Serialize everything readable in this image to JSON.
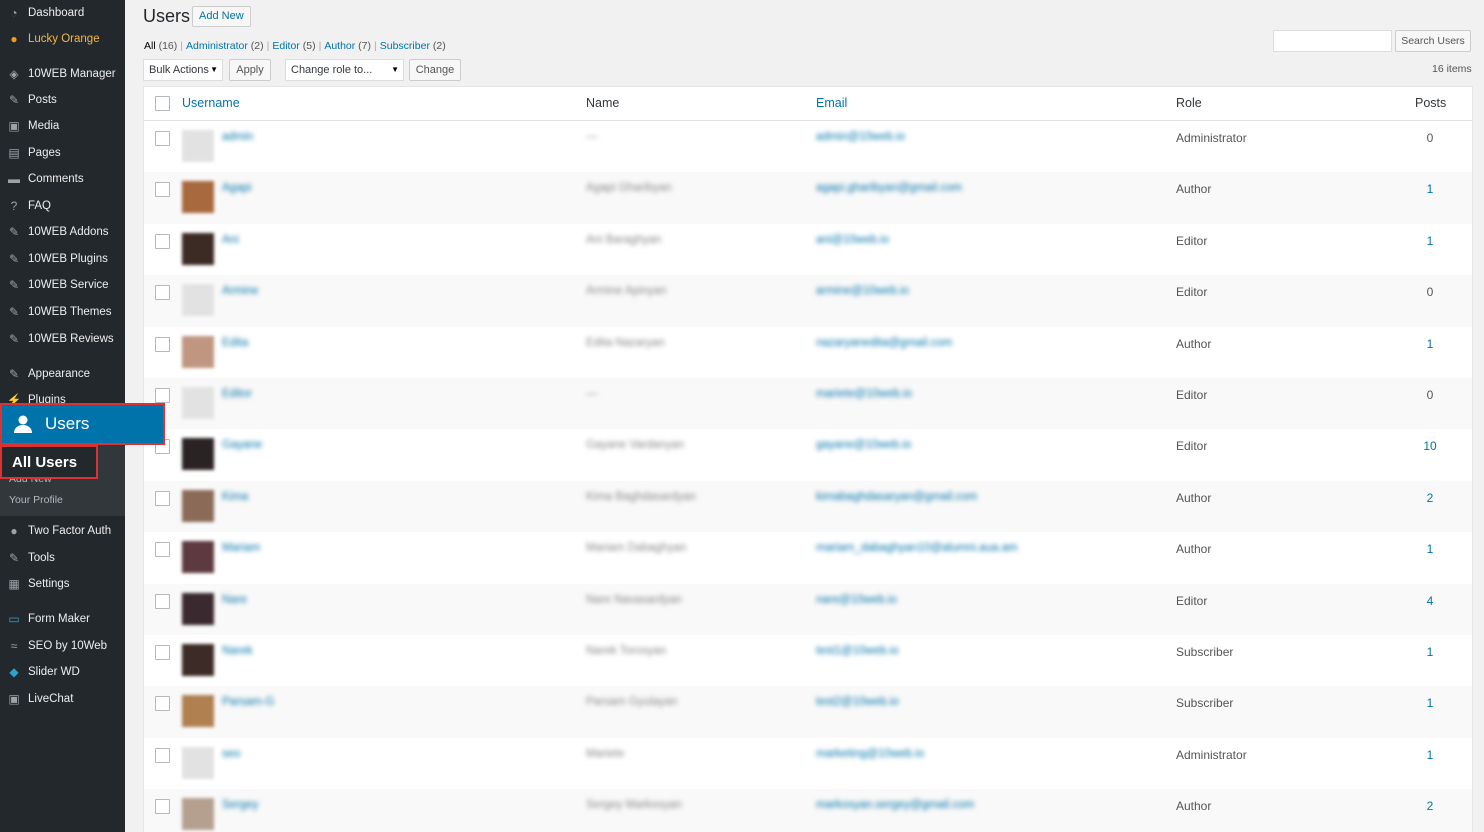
{
  "sidebar": {
    "items": [
      {
        "label": "Dashboard",
        "icon": "dashboard-icon"
      },
      {
        "label": "Lucky Orange",
        "icon": "lucky-orange-icon"
      },
      {
        "label": "10WEB Manager",
        "icon": "diamond-icon"
      },
      {
        "label": "Posts",
        "icon": "pin-icon"
      },
      {
        "label": "Media",
        "icon": "media-icon"
      },
      {
        "label": "Pages",
        "icon": "pages-icon"
      },
      {
        "label": "Comments",
        "icon": "comment-icon"
      },
      {
        "label": "FAQ",
        "icon": "question-icon"
      },
      {
        "label": "10WEB Addons",
        "icon": "pin-icon"
      },
      {
        "label": "10WEB Plugins",
        "icon": "pin-icon"
      },
      {
        "label": "10WEB Service",
        "icon": "pin-icon"
      },
      {
        "label": "10WEB Themes",
        "icon": "pin-icon"
      },
      {
        "label": "10WEB Reviews",
        "icon": "pin-icon"
      },
      {
        "label": "Appearance",
        "icon": "brush-icon"
      },
      {
        "label": "Plugins",
        "icon": "plug-icon"
      },
      {
        "label": "Two Factor Auth",
        "icon": "lock-icon"
      },
      {
        "label": "Tools",
        "icon": "wrench-icon"
      },
      {
        "label": "Settings",
        "icon": "settings-icon"
      },
      {
        "label": "Form Maker",
        "icon": "form-icon"
      },
      {
        "label": "SEO by 10Web",
        "icon": "seo-icon"
      },
      {
        "label": "Slider WD",
        "icon": "slider-icon"
      },
      {
        "label": "LiveChat",
        "icon": "chat-icon"
      }
    ],
    "users_label": "Users",
    "submenu": {
      "all_users": "All Users",
      "add_new": "Add New",
      "your_profile": "Your Profile"
    }
  },
  "header": {
    "title": "Users",
    "add_new": "Add New"
  },
  "filters": [
    {
      "label": "All",
      "count": "(16)"
    },
    {
      "label": "Administrator",
      "count": "(2)"
    },
    {
      "label": "Editor",
      "count": "(5)"
    },
    {
      "label": "Author",
      "count": "(7)"
    },
    {
      "label": "Subscriber",
      "count": "(2)"
    }
  ],
  "search": {
    "button": "Search Users",
    "value": ""
  },
  "toolbar": {
    "bulk_actions": "Bulk Actions",
    "apply": "Apply",
    "change_role": "Change role to...",
    "change": "Change",
    "items_count": "16 items"
  },
  "table": {
    "columns": {
      "username": "Username",
      "name": "Name",
      "email": "Email",
      "role": "Role",
      "posts": "Posts"
    },
    "rows": [
      {
        "username": "admin",
        "name": "—",
        "email": "admin@10web.io",
        "role": "Administrator",
        "posts": "0",
        "avatar": "#e2e2e2"
      },
      {
        "username": "Agapi",
        "name": "Agapi Gharibyan",
        "email": "agapi.gharibyan@gmail.com",
        "role": "Author",
        "posts": "1",
        "avatar": "#a8693f"
      },
      {
        "username": "Ani",
        "name": "Ani Baraghyan",
        "email": "ani@10web.io",
        "role": "Editor",
        "posts": "1",
        "avatar": "#3c2a24"
      },
      {
        "username": "Armine",
        "name": "Armine Apinyan",
        "email": "armine@10web.io",
        "role": "Editor",
        "posts": "0",
        "avatar": "#e2e2e2"
      },
      {
        "username": "Edita",
        "name": "Edita Nazaryan",
        "email": "nazaryanedita@gmail.com",
        "role": "Author",
        "posts": "1",
        "avatar": "#c09680"
      },
      {
        "username": "Editor",
        "name": "—",
        "email": "mariete@10web.io",
        "role": "Editor",
        "posts": "0",
        "avatar": "#e2e2e2"
      },
      {
        "username": "Gayane",
        "name": "Gayane Vardanyan",
        "email": "gayane@10web.io",
        "role": "Editor",
        "posts": "10",
        "avatar": "#2a2323"
      },
      {
        "username": "Kima",
        "name": "Kima Baghdasardyan",
        "email": "kimabaghdasaryan@gmail.com",
        "role": "Author",
        "posts": "2",
        "avatar": "#8b6a58"
      },
      {
        "username": "Mariam",
        "name": "Mariam Dabaghyan",
        "email": "mariam_dabaghyan10@alumni.aua.am",
        "role": "Author",
        "posts": "1",
        "avatar": "#5c3a3f"
      },
      {
        "username": "Nare",
        "name": "Nare Navasardyan",
        "email": "nare@10web.io",
        "role": "Editor",
        "posts": "4",
        "avatar": "#3a2a30"
      },
      {
        "username": "Narek",
        "name": "Narek Torosyan",
        "email": "test1@10web.io",
        "role": "Subscriber",
        "posts": "1",
        "avatar": "#3c2b26"
      },
      {
        "username": "Parsam-G",
        "name": "Parsam Gyulayan",
        "email": "test2@10web.io",
        "role": "Subscriber",
        "posts": "1",
        "avatar": "#b08050"
      },
      {
        "username": "seo",
        "name": "Mariete",
        "email": "marketing@10web.io",
        "role": "Administrator",
        "posts": "1",
        "avatar": "#e2e2e2"
      },
      {
        "username": "Sergey",
        "name": "Sergey Markosyan",
        "email": "markosyan.sergey@gmail.com",
        "role": "Author",
        "posts": "2",
        "avatar": "#b5a090"
      }
    ]
  }
}
